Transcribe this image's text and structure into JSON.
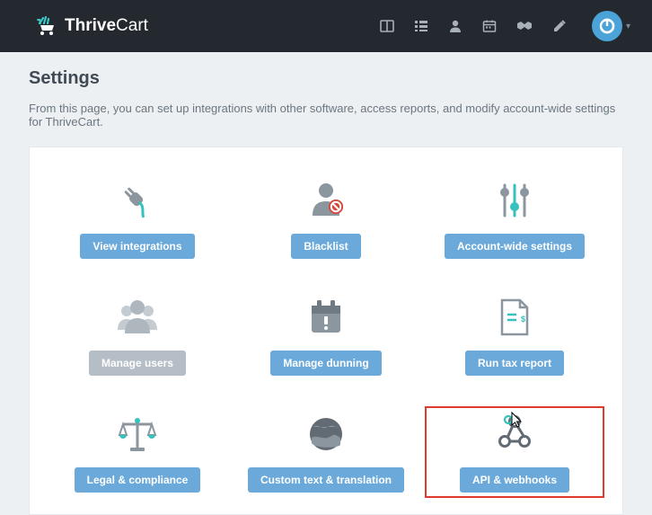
{
  "brand": {
    "name_strong": "Thrive",
    "name_light": "Cart"
  },
  "page": {
    "title": "Settings",
    "description": "From this page, you can set up integrations with other software, access reports, and modify account-wide settings for ThriveCart."
  },
  "tiles": {
    "integrations": "View integrations",
    "blacklist": "Blacklist",
    "account": "Account-wide settings",
    "users": "Manage users",
    "dunning": "Manage dunning",
    "tax": "Run tax report",
    "legal": "Legal & compliance",
    "translation": "Custom text & translation",
    "api": "API & webhooks"
  }
}
